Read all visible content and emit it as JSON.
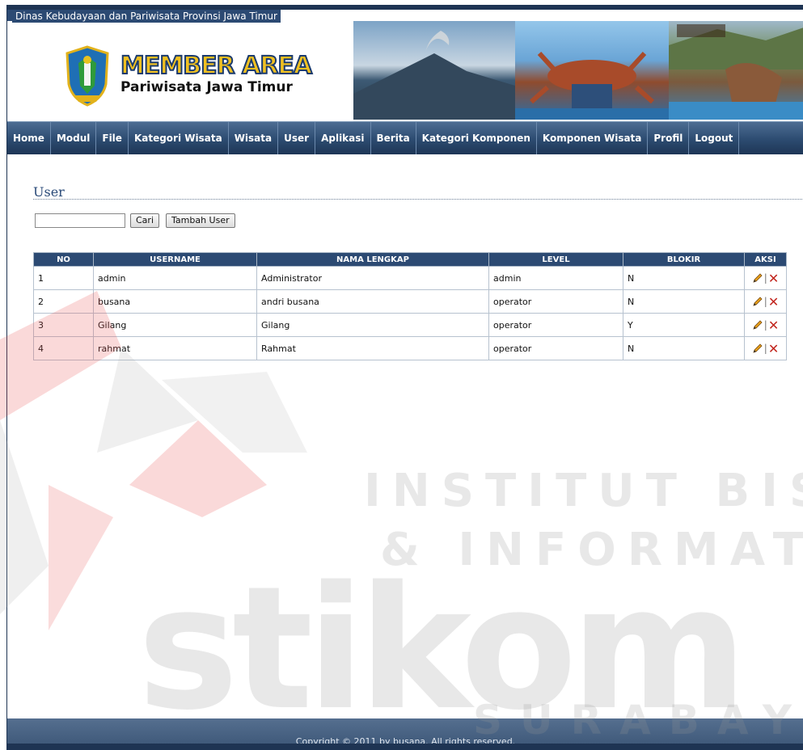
{
  "header": {
    "region_name": "Dinas Kebudayaan dan Pariwisata Provinsi Jawa Timur",
    "title": "MEMBER AREA",
    "subtitle": "Pariwisata Jawa Timur"
  },
  "nav": {
    "items": [
      "Home",
      "Modul",
      "File",
      "Kategori Wisata",
      "Wisata",
      "User",
      "Aplikasi",
      "Berita",
      "Kategori Komponen",
      "Komponen Wisata",
      "Profil",
      "Logout"
    ]
  },
  "page": {
    "title": "User",
    "search_value": "",
    "btn_search": "Cari",
    "btn_add": "Tambah User"
  },
  "table": {
    "columns": [
      "NO",
      "USERNAME",
      "NAMA LENGKAP",
      "LEVEL",
      "BLOKIR",
      "AKSI"
    ],
    "rows": [
      {
        "no": "1",
        "username": "admin",
        "nama": "Administrator",
        "level": "admin",
        "blokir": "N"
      },
      {
        "no": "2",
        "username": "busana",
        "nama": "andri busana",
        "level": "operator",
        "blokir": "N"
      },
      {
        "no": "3",
        "username": "Gilang",
        "nama": "Gilang",
        "level": "operator",
        "blokir": "Y"
      },
      {
        "no": "4",
        "username": "rahmat",
        "nama": "Rahmat",
        "level": "operator",
        "blokir": "N"
      }
    ],
    "action_separator": "|",
    "delete_glyph": "✕"
  },
  "footer": {
    "copyright": "Copyright © 2011 by busana. All rights reserved."
  },
  "watermark": {
    "line1": "INSTITUT BISNIS",
    "line2": "& INFORMATIKA",
    "line3": "stikom",
    "line4": "SURABAYA"
  },
  "colors": {
    "nav": "#2c4b70",
    "table_header": "#2c4a73",
    "delete": "#c2271f"
  }
}
